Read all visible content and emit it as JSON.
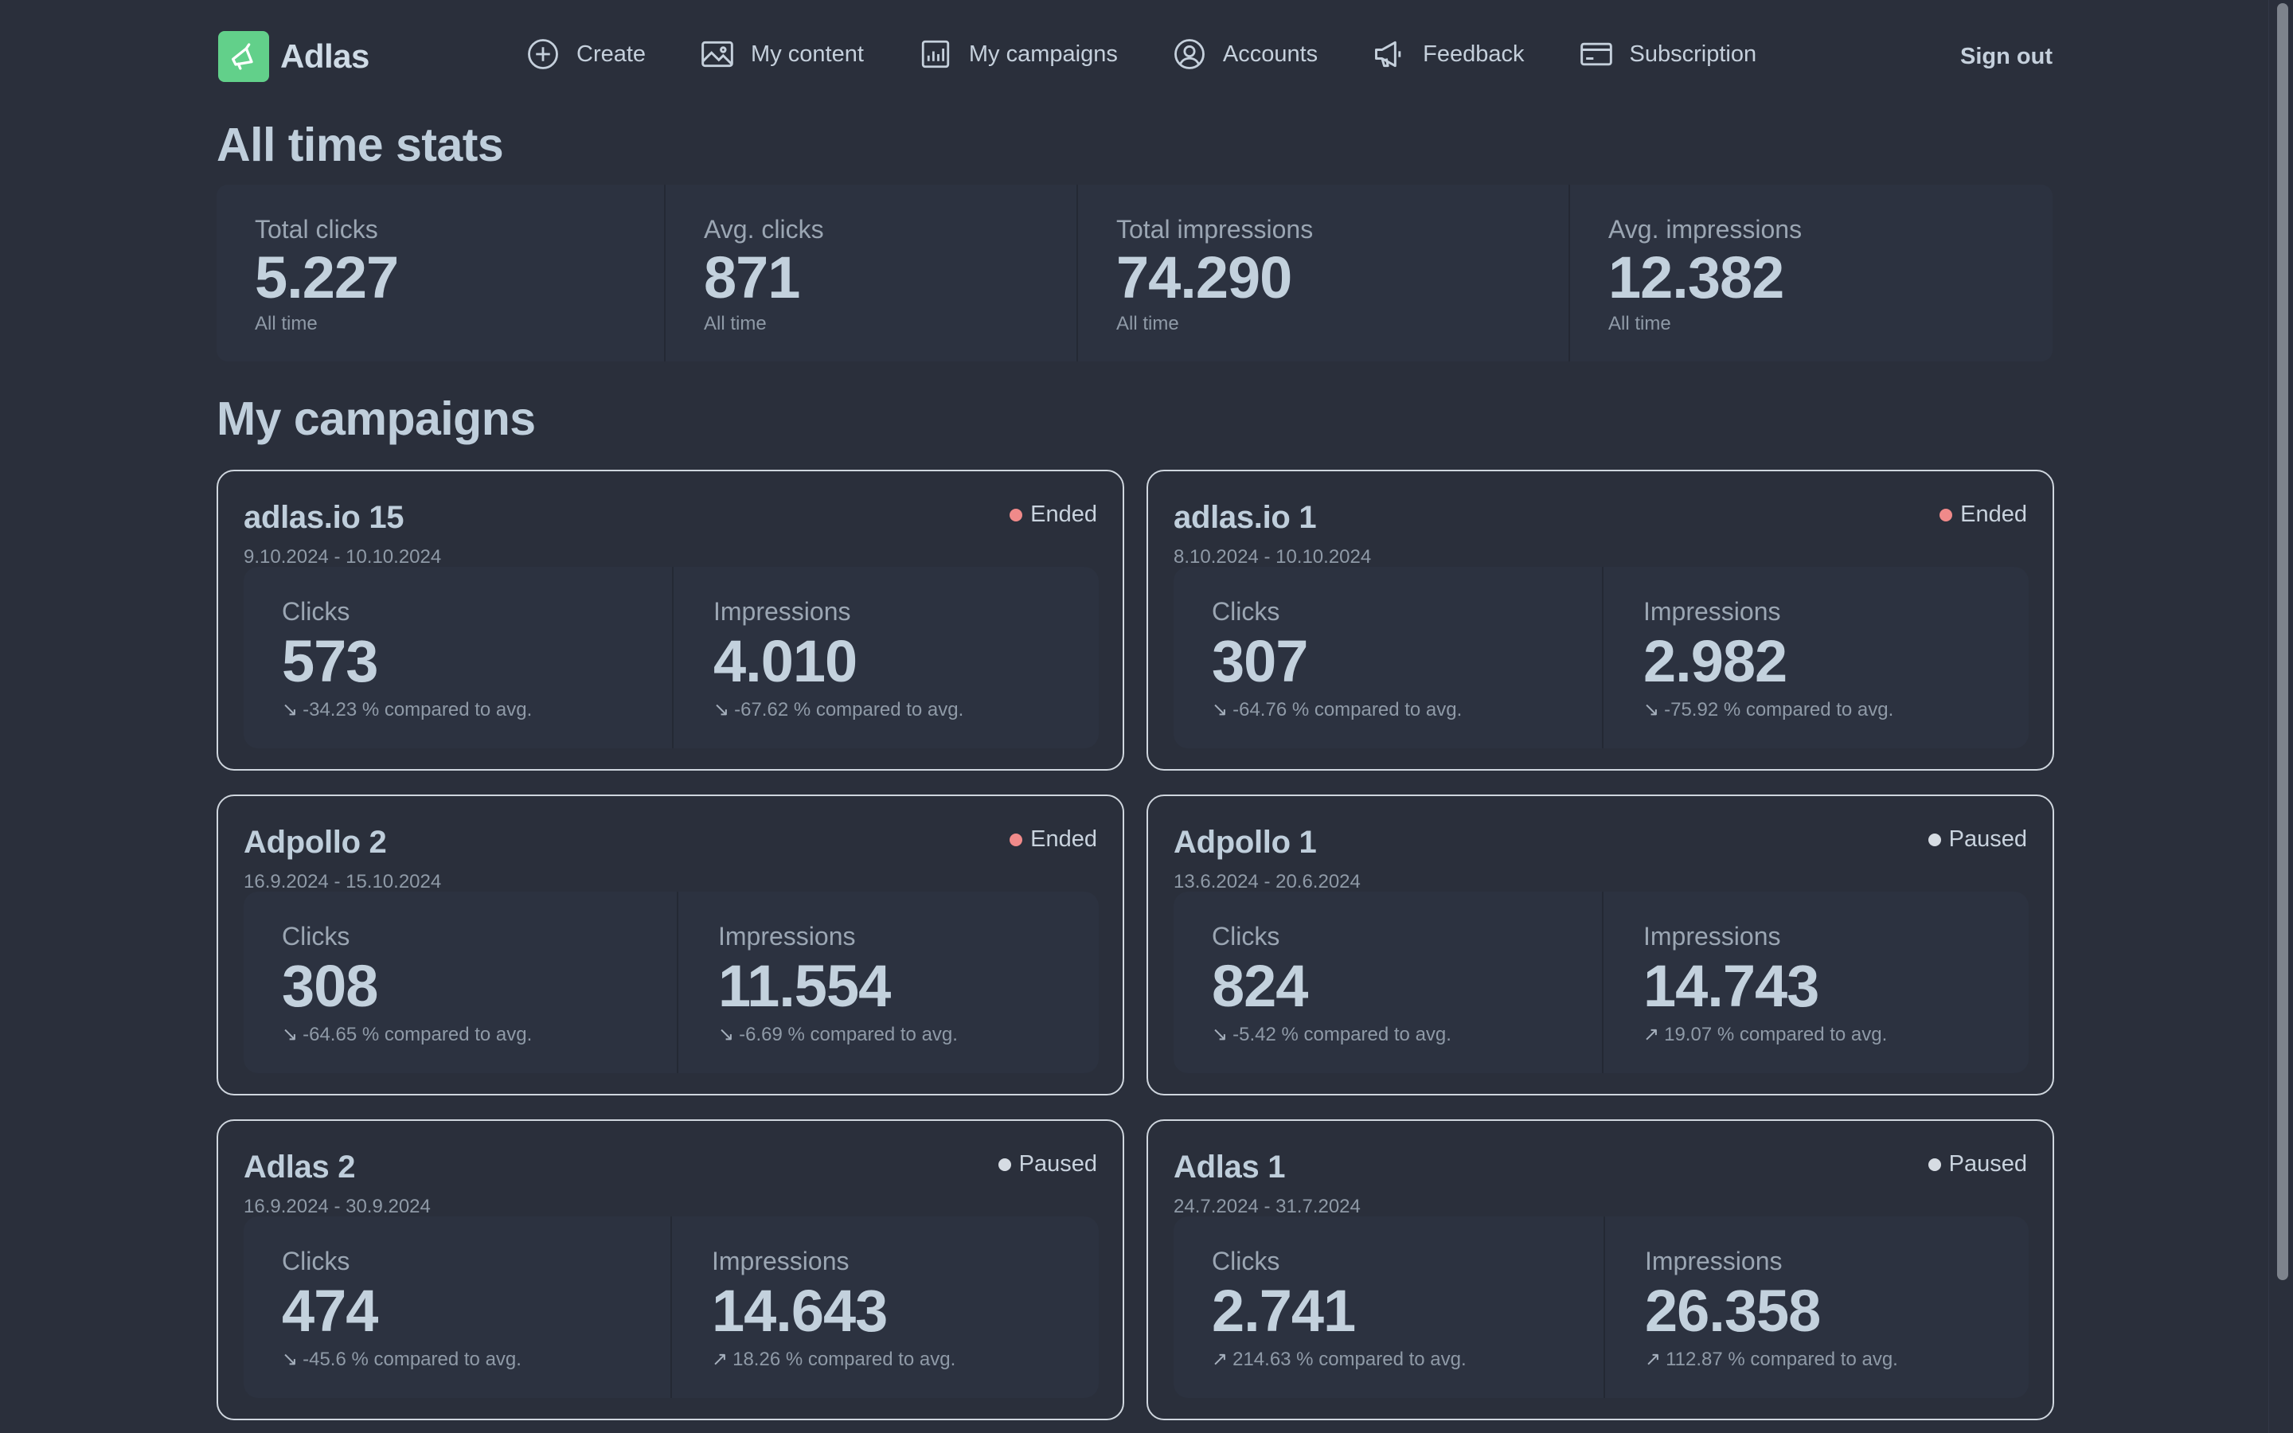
{
  "app": {
    "name": "Adlas",
    "accent": "#62d08a"
  },
  "nav": {
    "items": [
      {
        "label": "Create",
        "icon": "plus-circle-icon"
      },
      {
        "label": "My content",
        "icon": "image-icon"
      },
      {
        "label": "My campaigns",
        "icon": "bar-chart-icon"
      },
      {
        "label": "Accounts",
        "icon": "user-circle-icon"
      },
      {
        "label": "Feedback",
        "icon": "megaphone-icon"
      },
      {
        "label": "Subscription",
        "icon": "credit-card-icon"
      }
    ],
    "sign_out": "Sign out"
  },
  "stats": {
    "heading": "All time stats",
    "items": [
      {
        "label": "Total clicks",
        "value": "5.227",
        "desc": "All time"
      },
      {
        "label": "Avg. clicks",
        "value": "871",
        "desc": "All time"
      },
      {
        "label": "Total impressions",
        "value": "74.290",
        "desc": "All time"
      },
      {
        "label": "Avg. impressions",
        "value": "12.382",
        "desc": "All time"
      }
    ]
  },
  "campaigns": {
    "heading": "My campaigns",
    "status_colors": {
      "Ended": "#f08a8a",
      "Paused": "#d6dce3"
    },
    "items": [
      {
        "title": "adlas.io 15",
        "date": "9.10.2024 - 10.10.2024",
        "status": "Ended",
        "clicks_label": "Clicks",
        "clicks": "573",
        "clicks_arrow": "↘",
        "clicks_desc": "-34.23 % compared to avg.",
        "impr_label": "Impressions",
        "impressions": "4.010",
        "impr_arrow": "↘",
        "impr_desc": "-67.62 % compared to avg."
      },
      {
        "title": "adlas.io 1",
        "date": "8.10.2024 - 10.10.2024",
        "status": "Ended",
        "clicks_label": "Clicks",
        "clicks": "307",
        "clicks_arrow": "↘",
        "clicks_desc": "-64.76 % compared to avg.",
        "impr_label": "Impressions",
        "impressions": "2.982",
        "impr_arrow": "↘",
        "impr_desc": "-75.92 % compared to avg."
      },
      {
        "title": "Adpollo 2",
        "date": "16.9.2024 - 15.10.2024",
        "status": "Ended",
        "clicks_label": "Clicks",
        "clicks": "308",
        "clicks_arrow": "↘",
        "clicks_desc": "-64.65 % compared to avg.",
        "impr_label": "Impressions",
        "impressions": "11.554",
        "impr_arrow": "↘",
        "impr_desc": "-6.69 % compared to avg."
      },
      {
        "title": "Adpollo 1",
        "date": "13.6.2024 - 20.6.2024",
        "status": "Paused",
        "clicks_label": "Clicks",
        "clicks": "824",
        "clicks_arrow": "↘",
        "clicks_desc": "-5.42 % compared to avg.",
        "impr_label": "Impressions",
        "impressions": "14.743",
        "impr_arrow": "↗",
        "impr_desc": "19.07 % compared to avg."
      },
      {
        "title": "Adlas 2",
        "date": "16.9.2024 - 30.9.2024",
        "status": "Paused",
        "clicks_label": "Clicks",
        "clicks": "474",
        "clicks_arrow": "↘",
        "clicks_desc": "-45.6 % compared to avg.",
        "impr_label": "Impressions",
        "impressions": "14.643",
        "impr_arrow": "↗",
        "impr_desc": "18.26 % compared to avg."
      },
      {
        "title": "Adlas 1",
        "date": "24.7.2024 - 31.7.2024",
        "status": "Paused",
        "clicks_label": "Clicks",
        "clicks": "2.741",
        "clicks_arrow": "↗",
        "clicks_desc": "214.63 % compared to avg.",
        "impr_label": "Impressions",
        "impressions": "26.358",
        "impr_arrow": "↗",
        "impr_desc": "112.87 % compared to avg."
      }
    ]
  }
}
